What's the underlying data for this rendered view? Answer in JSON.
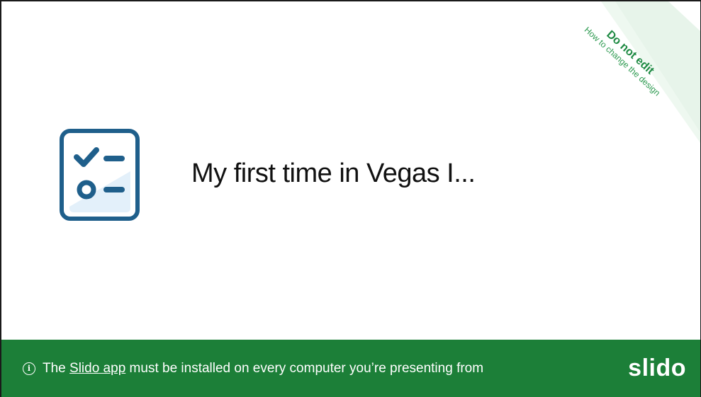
{
  "slide": {
    "title": "My first time in Vegas I..."
  },
  "corner": {
    "main": "Do not edit",
    "sub": "How to change the design"
  },
  "footer": {
    "prefix": "The ",
    "link": "Slido app",
    "suffix": " must be installed on every computer you’re presenting from",
    "logo": "slido"
  },
  "colors": {
    "brand_green": "#1c7f38",
    "icon_blue": "#1f5f8b"
  },
  "icons": {
    "poll": "poll-checklist-icon",
    "info": "info-icon"
  }
}
